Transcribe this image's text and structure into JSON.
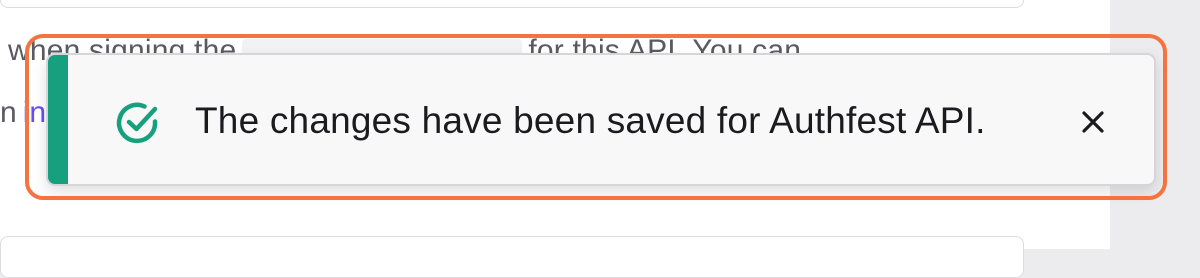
{
  "background": {
    "line1_before": "when signing the",
    "line1_after": "for this API. You can",
    "line2_prefix": "n",
    "line2_link": "in"
  },
  "toast": {
    "message": "The changes have been saved for Authfest API.",
    "status_icon": "check-circle-icon",
    "close_icon": "close-icon",
    "accent_color": "#16a07d",
    "highlight_color": "#f4733f"
  }
}
